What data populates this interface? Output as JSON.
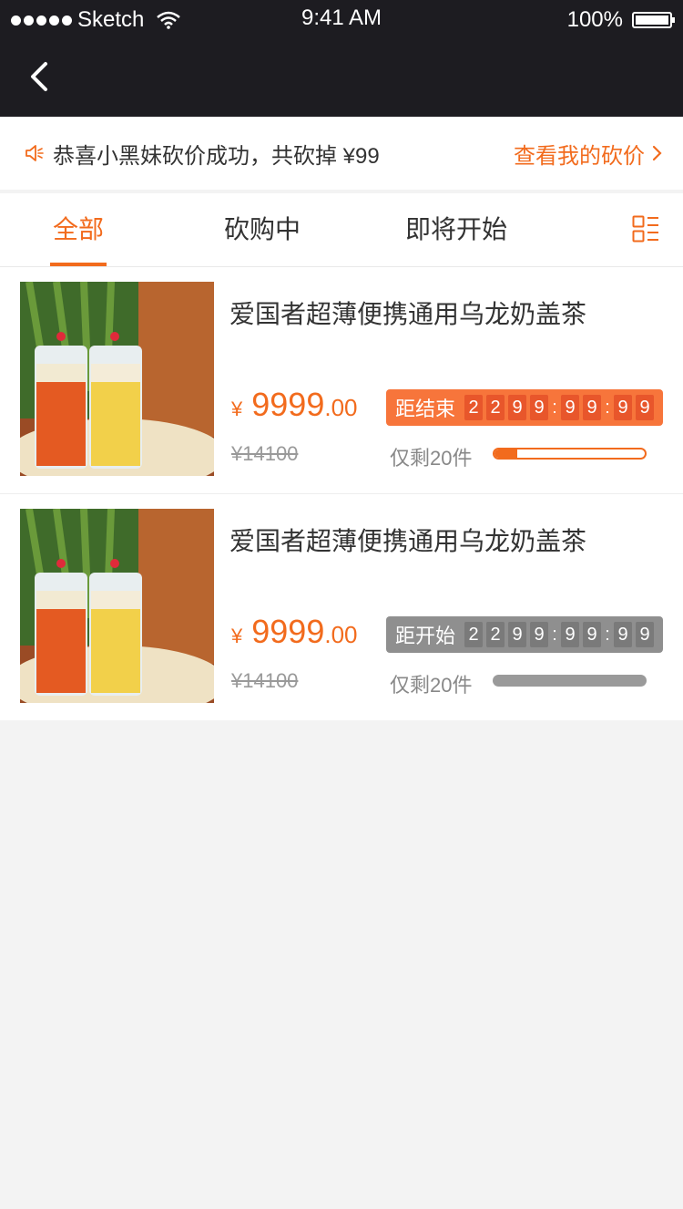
{
  "status_bar": {
    "carrier": "Sketch",
    "time": "9:41 AM",
    "battery": "100%"
  },
  "notice": {
    "text": "恭喜小黑妹砍价成功，共砍掉 ¥99",
    "link_label": "查看我的砍价"
  },
  "tabs": [
    {
      "label": "全部",
      "active": true
    },
    {
      "label": "砍购中",
      "active": false
    },
    {
      "label": "即将开始",
      "active": false
    }
  ],
  "colors": {
    "accent": "#f26b1d",
    "dark_header": "#1d1c21",
    "gray_timer": "#8f8f8f"
  },
  "products": [
    {
      "title": "爱国者超薄便携通用乌龙奶盖茶",
      "currency": "¥",
      "price_int": "9999",
      "price_dec": ".00",
      "original_price": "¥14100",
      "timer_label": "距结束",
      "timer_digits": [
        "2",
        "2",
        "9",
        "9",
        ":",
        "9",
        "9",
        ":",
        "9",
        "9"
      ],
      "stock_text": "仅剩20件",
      "progress": 0.15,
      "state": "ongoing"
    },
    {
      "title": "爱国者超薄便携通用乌龙奶盖茶",
      "currency": "¥",
      "price_int": "9999",
      "price_dec": ".00",
      "original_price": "¥14100",
      "timer_label": "距开始",
      "timer_digits": [
        "2",
        "2",
        "9",
        "9",
        ":",
        "9",
        "9",
        ":",
        "9",
        "9"
      ],
      "stock_text": "仅剩20件",
      "progress": 1.0,
      "state": "upcoming"
    }
  ]
}
